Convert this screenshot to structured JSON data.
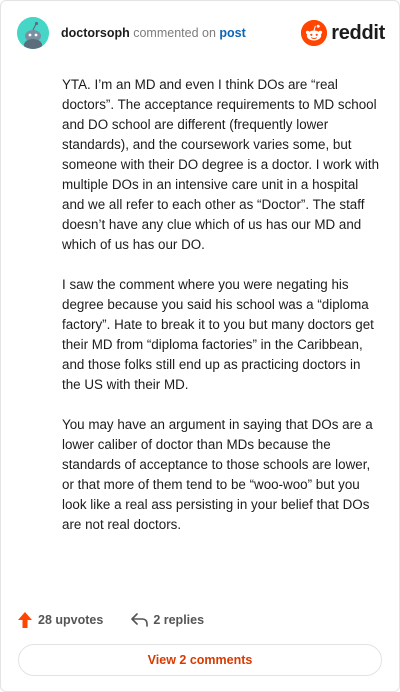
{
  "header": {
    "username": "doctorsoph",
    "verb": "commented on",
    "post_link": "post",
    "logo_text": "reddit",
    "avatar_icon": "snoo-avatar-icon",
    "logo_icon": "reddit-logo-icon"
  },
  "comment": {
    "paragraphs": [
      "YTA. I’m an MD and even I think DOs are “real doctors”. The acceptance requirements to MD school and DO school are different (frequently lower standards), and the coursework varies some, but someone with their DO degree is a doctor. I work with multiple DOs in an intensive care unit in a hospital and we all refer to each other as “Doctor”. The staff doesn’t have any clue which of us has our MD and which of us has our DO.",
      "I saw the comment where you were negating his degree because you said his school was a “diploma factory”. Hate to break it to you but many doctors get their MD from “diploma factories” in the Caribbean, and those folks still end up as practicing doctors in the US with their MD.",
      "You may have an argument in saying that DOs are a lower caliber of doctor than MDs because the standards of acceptance to those schools are lower, or that more of them tend to be “woo-woo” but you look like a real ass persisting in your belief that DOs are not real doctors."
    ]
  },
  "footer": {
    "upvotes": "28 upvotes",
    "replies": "2 replies",
    "view_comments": "View 2 comments",
    "upvote_icon": "upvote-arrow-icon",
    "reply_icon": "reply-arrow-icon"
  },
  "colors": {
    "brand": "#ff4500",
    "link": "#0a66b8",
    "avatar_bg": "#46d6c8",
    "view_comments_text": "#d93a00"
  }
}
